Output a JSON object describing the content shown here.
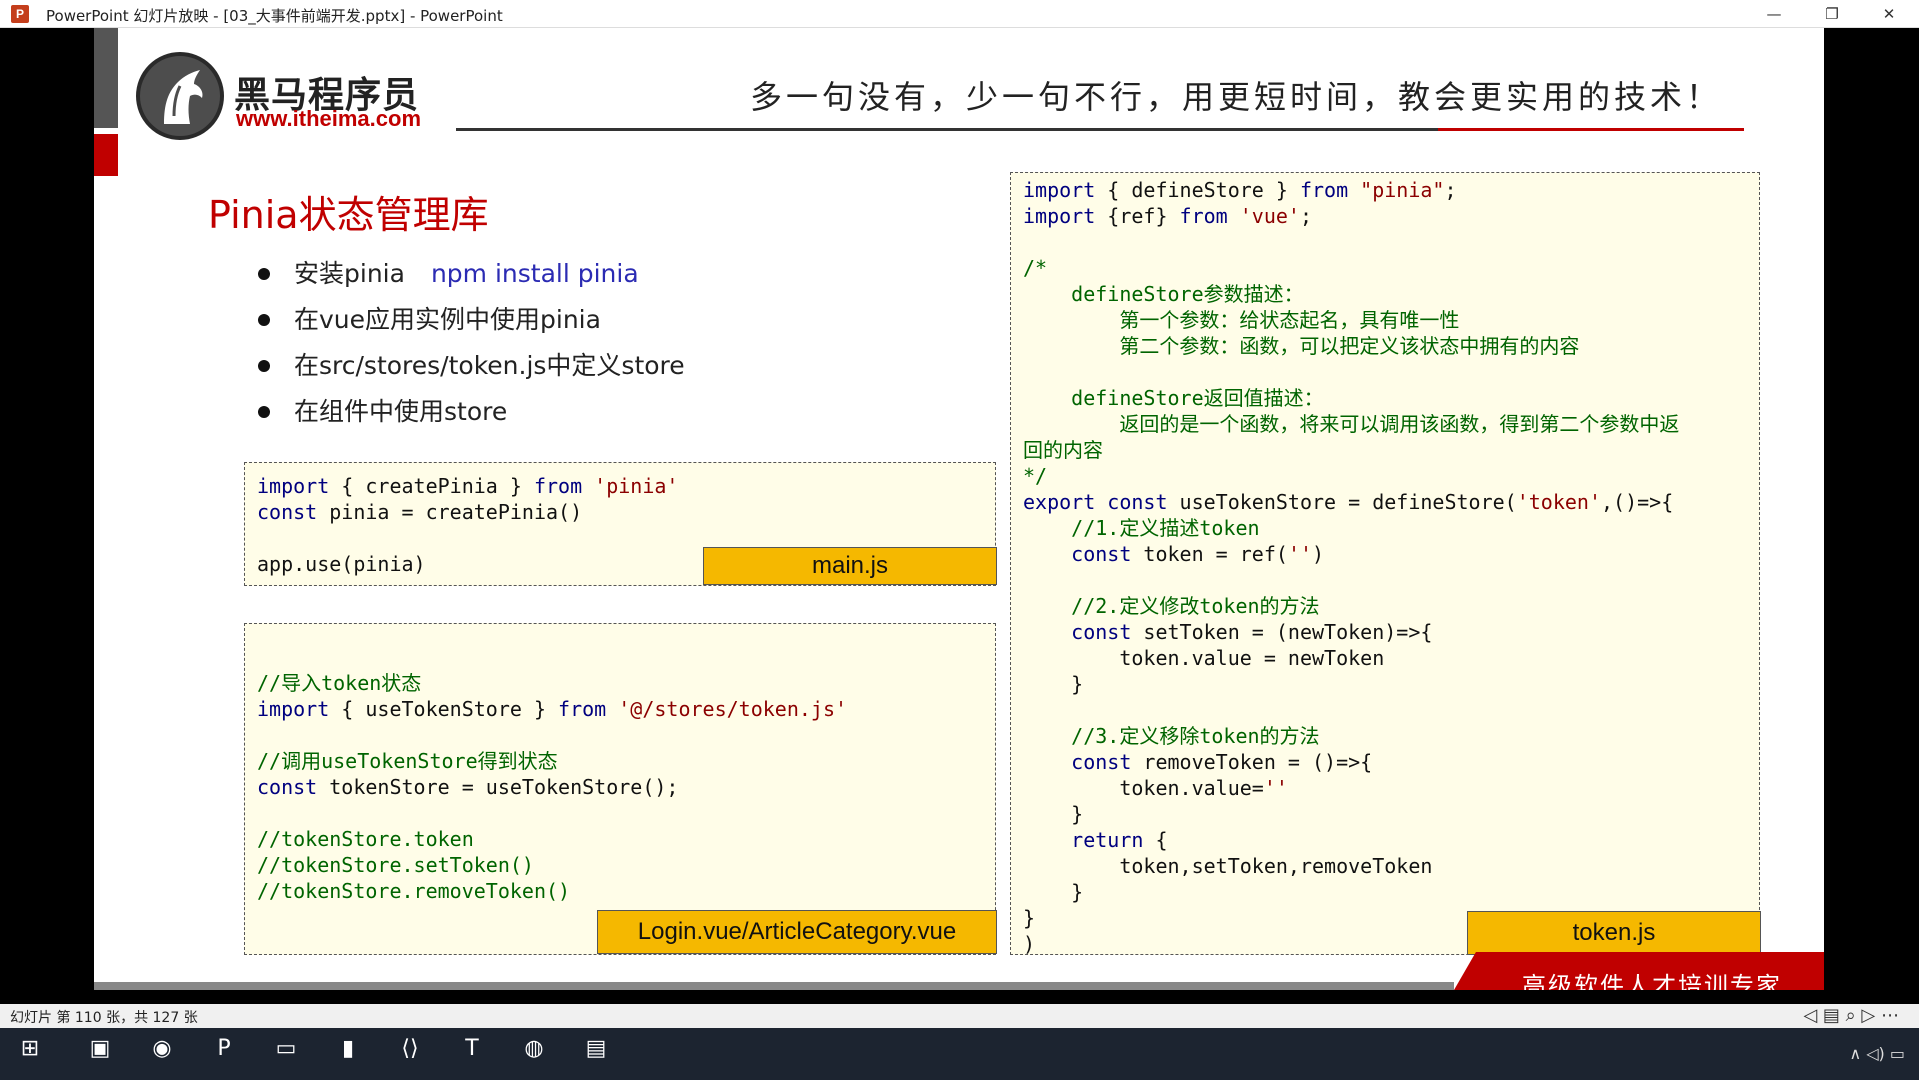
{
  "window": {
    "app_icon": "P",
    "title": "PowerPoint 幻灯片放映 - [03_大事件前端开发.pptx] - PowerPoint",
    "minimize": "—",
    "restore": "❐",
    "close": "✕"
  },
  "slide": {
    "logo_name": "黑马程序员",
    "logo_url": "www.itheima.com",
    "slogan": "多一句没有，少一句不行，用更短时间，教会更实用的技术！",
    "title": "Pinia状态管理库",
    "bullets": [
      {
        "text": "安装pinia",
        "cmd": "npm install pinia"
      },
      {
        "text": "在vue应用实例中使用pinia",
        "cmd": ""
      },
      {
        "text": "在src/stores/token.js中定义store",
        "cmd": ""
      },
      {
        "text": "在组件中使用store",
        "cmd": ""
      }
    ],
    "main_code": [
      "import { createPinia } from 'pinia'",
      "const pinia = createPinia()",
      "",
      "app.use(pinia)"
    ],
    "main_file": "main.js",
    "login_code": [
      "//导入token状态",
      "import { useTokenStore } from '@/stores/token.js'",
      "",
      "//调用useTokenStore得到状态",
      "const tokenStore = useTokenStore();",
      "",
      "//tokenStore.token",
      "//tokenStore.setToken()",
      "//tokenStore.removeToken()"
    ],
    "login_file": "Login.vue/ArticleCategory.vue",
    "token_code": [
      "import { defineStore } from \"pinia\";",
      "import {ref} from 'vue';",
      "",
      "/*",
      "    defineStore参数描述：",
      "        第一个参数：给状态起名，具有唯一性",
      "        第二个参数：函数，可以把定义该状态中拥有的内容",
      "",
      "    defineStore返回值描述：",
      "        返回的是一个函数，将来可以调用该函数，得到第二个参数中返",
      "回的内容",
      "*/",
      "export const useTokenStore = defineStore('token',()=>{",
      "    //1.定义描述token",
      "    const token = ref('')",
      "",
      "    //2.定义修改token的方法",
      "    const setToken = (newToken)=>{",
      "        token.value = newToken",
      "    }",
      "",
      "    //3.定义移除token的方法",
      "    const removeToken = ()=>{",
      "        token.value=''",
      "    }",
      "    return {",
      "        token,setToken,removeToken",
      "    }",
      "}",
      ")"
    ],
    "token_file": "token.js",
    "footer_slogan": "高级软件人才培训专家"
  },
  "statusbar": {
    "slide_info": "幻灯片 第 110 张，共 127 张",
    "controls": "◁  ▤  ⌕  ▷  ⋯"
  },
  "taskbar": {
    "start_icon": "⊞",
    "apps": [
      "▣",
      "◉",
      "P",
      "▭",
      "▮",
      "⟨⟩",
      "T",
      "◍",
      "▤"
    ],
    "tray": "∧  ◁)  ▭"
  }
}
